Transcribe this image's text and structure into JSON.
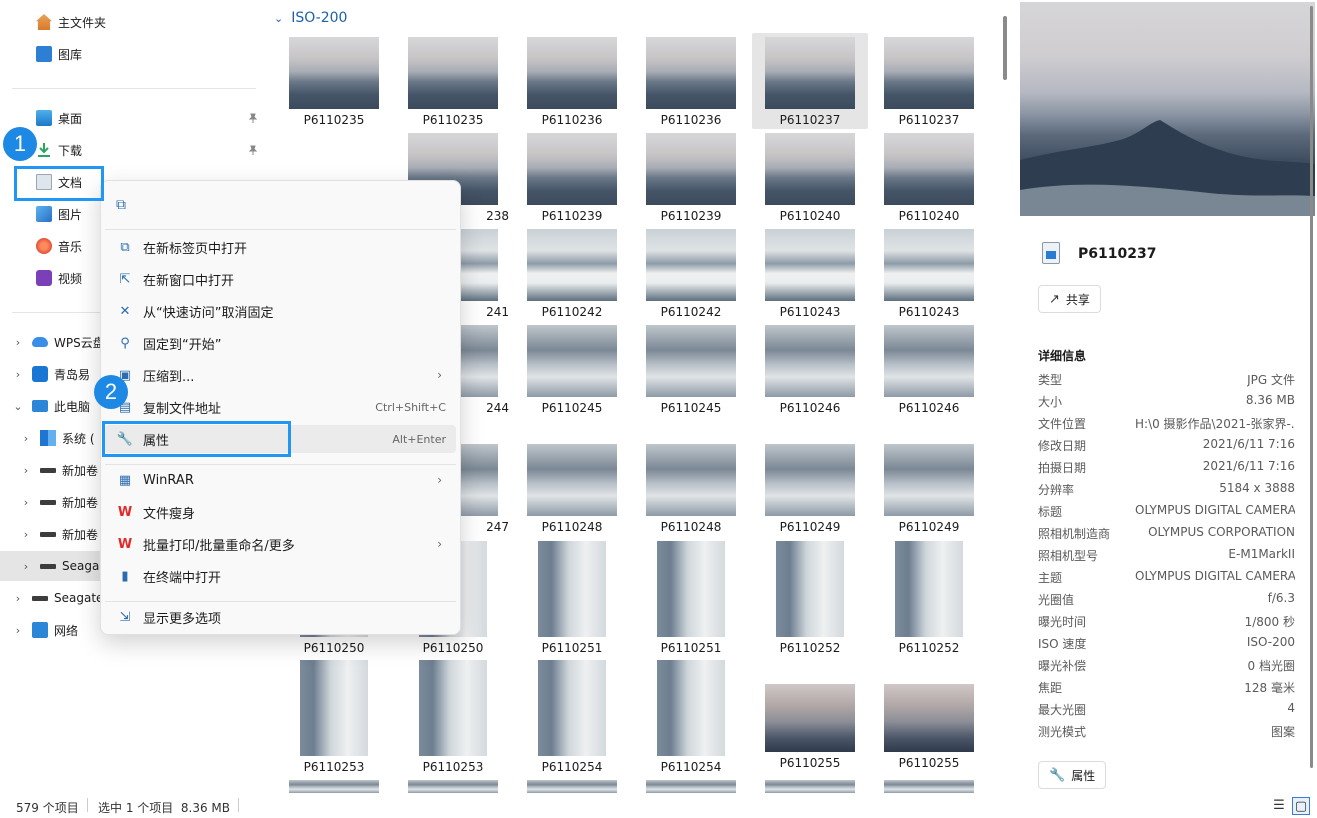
{
  "sidebar": {
    "quick": [
      {
        "label": "主文件夹",
        "icon": "home-icon"
      },
      {
        "label": "图库",
        "icon": "gallery-icon"
      }
    ],
    "pinned": [
      {
        "label": "桌面",
        "icon": "desktop-icon"
      },
      {
        "label": "下载",
        "icon": "download-icon"
      },
      {
        "label": "文档",
        "icon": "documents-icon"
      },
      {
        "label": "图片",
        "icon": "pictures-icon"
      },
      {
        "label": "音乐",
        "icon": "music-icon"
      },
      {
        "label": "视频",
        "icon": "videos-icon"
      }
    ],
    "tree": [
      {
        "label": "WPS云盘",
        "chevron": "›"
      },
      {
        "label": "青岛易",
        "chevron": "›"
      },
      {
        "label": "此电脑",
        "chevron": "⌄"
      },
      {
        "label": "系统 (",
        "chevron": "›"
      },
      {
        "label": "新加卷",
        "chevron": "›"
      },
      {
        "label": "新加卷",
        "chevron": "›"
      },
      {
        "label": "新加卷",
        "chevron": "›"
      },
      {
        "label": "Seaga",
        "chevron": "›"
      },
      {
        "label": "Seagate",
        "chevron": "›"
      },
      {
        "label": "网络",
        "chevron": "›"
      }
    ]
  },
  "badges": {
    "step1": "1",
    "step2": "2"
  },
  "group": {
    "chevron": "⌄",
    "label": "ISO-200"
  },
  "thumbnails": [
    [
      "P6110235",
      "P6110235",
      "P6110236",
      "P6110236",
      "P6110237",
      "P6110237"
    ],
    [
      "",
      "238",
      "P6110239",
      "P6110239",
      "P6110240",
      "P6110240"
    ],
    [
      "",
      "241",
      "P6110242",
      "P6110242",
      "P6110243",
      "P6110243"
    ],
    [
      "",
      "244",
      "P6110245",
      "P6110245",
      "P6110246",
      "P6110246"
    ],
    [
      "",
      "247",
      "P6110248",
      "P6110248",
      "P6110249",
      "P6110249"
    ],
    [
      "",
      "P6110250",
      "P6110251",
      "P6110251",
      "P6110252",
      "P6110252"
    ],
    [
      "P6110253",
      "P6110253",
      "P6110254",
      "P6110254",
      "P6110255",
      "P6110255"
    ]
  ],
  "row5_first": "P6110250",
  "context_menu": {
    "copy_icon": "⧉",
    "items": [
      {
        "label": "在新标签页中打开",
        "icon": "⧉",
        "accel": "",
        "arrow": ""
      },
      {
        "label": "在新窗口中打开",
        "icon": "⇱",
        "accel": "",
        "arrow": ""
      },
      {
        "label": "从“快速访问”取消固定",
        "icon": "✕",
        "accel": "",
        "arrow": ""
      },
      {
        "label": "固定到“开始”",
        "icon": "⚲",
        "accel": "",
        "arrow": ""
      },
      {
        "label": "压缩到...",
        "icon": "▣",
        "accel": "",
        "arrow": "›"
      },
      {
        "label": "复制文件地址",
        "icon": "▤",
        "accel": "Ctrl+Shift+C",
        "arrow": ""
      },
      {
        "label": "属性",
        "icon": "🔧",
        "accel": "Alt+Enter",
        "arrow": ""
      }
    ],
    "items2": [
      {
        "label": "WinRAR",
        "icon": "▦",
        "accel": "",
        "arrow": "›"
      },
      {
        "label": "文件瘦身",
        "icon": "W",
        "accel": "",
        "arrow": ""
      },
      {
        "label": "批量打印/批量重命名/更多",
        "icon": "W",
        "accel": "",
        "arrow": "›"
      },
      {
        "label": "在终端中打开",
        "icon": "▮",
        "accel": "",
        "arrow": ""
      }
    ],
    "more": {
      "label": "显示更多选项",
      "icon": "⇲"
    }
  },
  "preview": {
    "file_name": "P6110237",
    "share_label": "共享",
    "share_icon": "↗",
    "details_title": "详细信息",
    "details": [
      {
        "k": "类型",
        "v": "JPG 文件"
      },
      {
        "k": "大小",
        "v": "8.36 MB"
      },
      {
        "k": "文件位置",
        "v": "H:\\0 摄影作品\\2021-张家界-..."
      },
      {
        "k": "修改日期",
        "v": "2021/6/11 7:16"
      },
      {
        "k": "拍摄日期",
        "v": "2021/6/11 7:16"
      },
      {
        "k": "分辨率",
        "v": "5184 x 3888"
      },
      {
        "k": "标题",
        "v": "OLYMPUS DIGITAL CAMERA"
      },
      {
        "k": "照相机制造商",
        "v": "OLYMPUS CORPORATION"
      },
      {
        "k": "照相机型号",
        "v": "E-M1MarkII"
      },
      {
        "k": "主题",
        "v": "OLYMPUS DIGITAL CAMERA"
      },
      {
        "k": "光圈值",
        "v": "f/6.3"
      },
      {
        "k": "曝光时间",
        "v": "1/800 秒"
      },
      {
        "k": "ISO 速度",
        "v": "ISO-200"
      },
      {
        "k": "曝光补偿",
        "v": "0 档光圈"
      },
      {
        "k": "焦距",
        "v": "128 毫米"
      },
      {
        "k": "最大光圈",
        "v": "4"
      },
      {
        "k": "测光模式",
        "v": "图案"
      }
    ],
    "properties_label": "属性",
    "properties_icon": "🔧"
  },
  "status": {
    "count": "579 个项目",
    "selection": "选中 1 个项目  8.36 MB",
    "details_view_icon": "☰",
    "tiles_view_icon": "▢"
  },
  "colors": {
    "accent": "#2196f3",
    "badge": "#1e88e5",
    "group_header": "#1e5fa8",
    "wps_red": "#e32a2a"
  }
}
